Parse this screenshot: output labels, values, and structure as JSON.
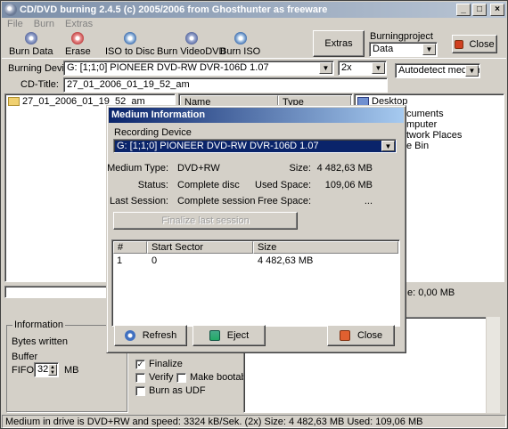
{
  "window": {
    "title": "CD/DVD burning 2.4.5 (c) 2005/2006 from Ghosthunter as freeware",
    "controls": [
      "_",
      "□",
      "×"
    ]
  },
  "menu": [
    "File",
    "Burn",
    "Extras"
  ],
  "toolbar": {
    "burn_data": "Burn Data",
    "erase": "Erase",
    "iso_to_disc": "ISO to Disc",
    "burn_video_dvd": "Burn VideoDVD",
    "burn_iso": "Burn ISO",
    "extras": "Extras",
    "burningproject_label": "Burningproject",
    "burningproject_value": "Data",
    "close": "Close"
  },
  "device": {
    "label": "Burning Device:",
    "value": "G: [1;1;0] PIONEER  DVD-RW  DVR-106D 1.07",
    "speed": "2x",
    "medium": "Autodetect medium"
  },
  "cd_title": {
    "label": "CD-Title:",
    "value": "27_01_2006_01_19_52_am"
  },
  "tree": {
    "item": "27_01_2006_01_19_52_am"
  },
  "file_list": {
    "columns": [
      "Name",
      "Type"
    ]
  },
  "explorer": {
    "items": [
      "Desktop",
      "cuments",
      "mputer",
      "twork Places",
      "e Bin"
    ]
  },
  "space_right": "e: 0,00 MB",
  "information": {
    "title": "Information",
    "bytes_written": "Bytes written",
    "buffer": "Buffer",
    "fifo_label": "FIFO:",
    "fifo_value": "32",
    "fifo_unit": "MB"
  },
  "options": {
    "finalize": "Finalize",
    "verify": "Verify",
    "make_bootable": "Make bootable",
    "burn_as_udf": "Burn as UDF"
  },
  "status": "Medium in drive is DVD+RW and speed: 3324 kB/Sek. (2x) Size: 4 482,63 MB Used: 109,06 MB",
  "dialog": {
    "title": "Medium Information",
    "recording_device_label": "Recording Device",
    "recording_device": "G: [1;1;0] PIONEER  DVD-RW  DVR-106D 1.07",
    "medium_type_label": "Medium Type:",
    "medium_type": "DVD+RW",
    "size_label": "Size:",
    "size": "4 482,63 MB",
    "status_label": "Status:",
    "status": "Complete disc",
    "used_space_label": "Used Space:",
    "used_space": "109,06 MB",
    "last_session_label": "Last Session:",
    "last_session": "Complete session",
    "free_space_label": "Free Space:",
    "free_space": "...",
    "finalize_button": "Finalize last session",
    "table": {
      "columns": [
        "#",
        "Start Sector",
        "Size"
      ],
      "rows": [
        [
          "1",
          "0",
          "4 482,63 MB"
        ]
      ]
    },
    "refresh": "Refresh",
    "eject": "Eject",
    "close": "Close"
  }
}
